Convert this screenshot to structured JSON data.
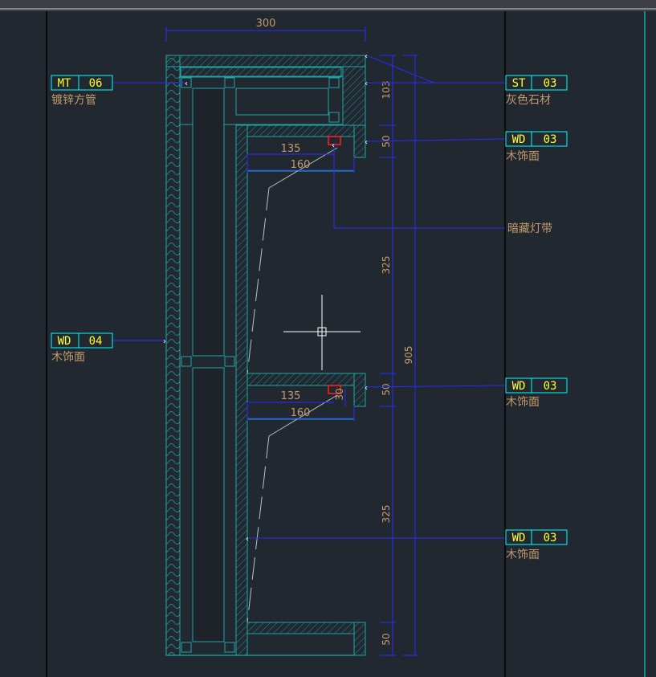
{
  "drawing": {
    "dimensions": {
      "top_width": "300",
      "seg_103": "103",
      "seg_50_a": "50",
      "seg_325_a": "325",
      "seg_50_b": "50",
      "seg_325_b": "325",
      "seg_50_c": "50",
      "overall": "905",
      "shelf1_inner": "135",
      "shelf1_outer": "160",
      "shelf2_inner": "135",
      "shelf2_outer": "160",
      "shelf2_small": "30"
    },
    "tags": [
      {
        "code": "MT",
        "num": "06",
        "material": "镀锌方管"
      },
      {
        "code": "ST",
        "num": "03",
        "material": "灰色石材"
      },
      {
        "code": "WD",
        "num": "03",
        "material": "木饰面"
      },
      {
        "code": "WD",
        "num": "04",
        "material": "木饰面"
      },
      {
        "code": "WD",
        "num": "03",
        "material": "木饰面"
      },
      {
        "code": "WD",
        "num": "03",
        "material": "木饰面"
      }
    ],
    "notes": {
      "hidden_light": "暗藏灯带"
    },
    "colors": {
      "background": "#212830",
      "tag_border": "#00ffff",
      "tag_text": "#ffff33",
      "leader": "#2a2aff",
      "material_text": "#c49a6c",
      "outline": "#1fa5a5",
      "light_marker": "#ff2020"
    }
  }
}
